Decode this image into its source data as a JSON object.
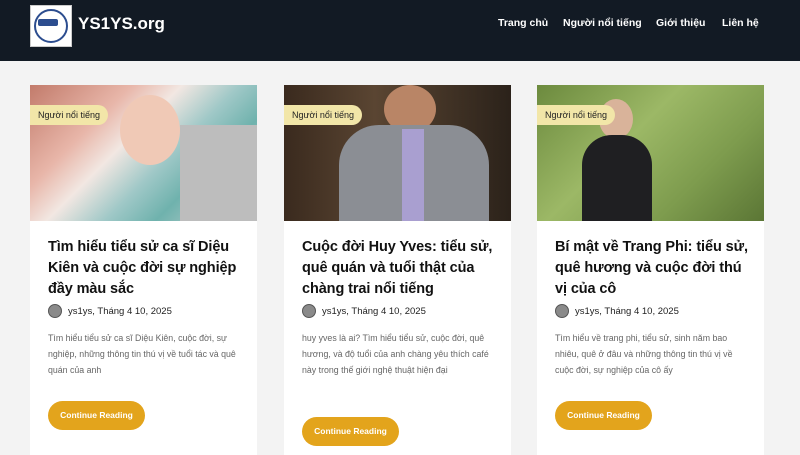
{
  "site": {
    "name": "YS1YS.org"
  },
  "nav": [
    "Trang chủ",
    "Người nổi tiếng",
    "Giới thiệu",
    "Liên hệ"
  ],
  "posts": [
    {
      "category": "Người nổi tiếng",
      "title": "Tìm hiểu tiểu sử ca sĩ Diệu Kiên và cuộc đời sự nghiệp đầy màu sắc",
      "author_date": "ys1ys, Tháng 4 10, 2025",
      "excerpt": "Tìm hiểu tiểu sử ca sĩ Diệu Kiên, cuộc đời, sự nghiệp, những thông tin thú vị về tuổi tác và quê quán của anh",
      "button": "Continue Reading"
    },
    {
      "category": "Người nổi tiếng",
      "title": "Cuộc đời Huy Yves: tiểu sử, quê quán và tuổi thật của chàng trai nổi tiếng",
      "author_date": "ys1ys, Tháng 4 10, 2025",
      "excerpt": "huy yves là ai? Tìm hiểu tiểu sử, cuộc đời, quê hương, và độ tuổi của anh chàng yêu thích café này trong thế giới nghệ thuật hiện đại",
      "button": "Continue Reading"
    },
    {
      "category": "Người nổi tiếng",
      "title": "Bí mật về Trang Phi: tiểu sử, quê hương và cuộc đời thú vị của cô",
      "author_date": "ys1ys, Tháng 4 10, 2025",
      "excerpt": "Tìm hiểu về trang phi, tiểu sử, sinh năm bao nhiêu, quê ở đâu và những thông tin thú vị về cuộc đời, sự nghiệp của cô ấy",
      "button": "Continue Reading"
    }
  ]
}
